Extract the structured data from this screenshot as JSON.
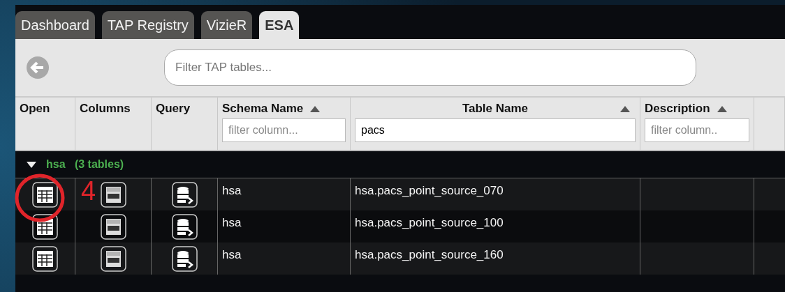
{
  "tabs": [
    {
      "label": "Dashboard",
      "selected": false
    },
    {
      "label": "TAP Registry",
      "selected": false
    },
    {
      "label": "VizieR",
      "selected": false
    },
    {
      "label": "ESA",
      "selected": true
    }
  ],
  "search": {
    "placeholder": "Filter TAP tables..."
  },
  "table": {
    "columns": [
      {
        "label": "Open",
        "sortable": false
      },
      {
        "label": "Columns",
        "sortable": false
      },
      {
        "label": "Query",
        "sortable": false
      },
      {
        "label": "Schema Name",
        "sortable": true,
        "filter": {
          "placeholder": "filter column..."
        }
      },
      {
        "label": "Table Name",
        "sortable": true,
        "filter": {
          "value": "pacs"
        }
      },
      {
        "label": "Description",
        "sortable": true,
        "filter": {
          "placeholder": "filter column.."
        }
      }
    ],
    "group": {
      "name": "hsa",
      "count": "(3 tables)",
      "expanded": true
    },
    "rows": [
      {
        "schema": "hsa",
        "table": "hsa.pacs_point_source_070"
      },
      {
        "schema": "hsa",
        "table": "hsa.pacs_point_source_100"
      },
      {
        "schema": "hsa",
        "table": "hsa.pacs_point_source_160"
      }
    ]
  },
  "annotation": {
    "label": "4"
  }
}
